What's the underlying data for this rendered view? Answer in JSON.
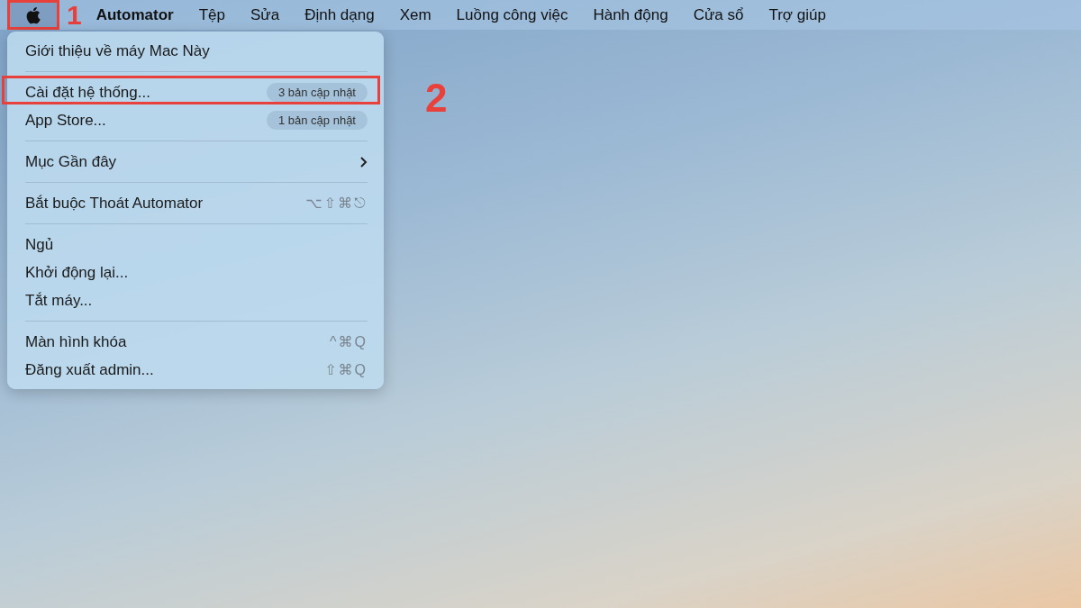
{
  "menu_bar": {
    "apple": {
      "selected": true,
      "annotation": "1"
    },
    "app_name": "Automator",
    "menus": [
      "Tệp",
      "Sửa",
      "Định dạng",
      "Xem",
      "Luồng công việc",
      "Hành động",
      "Cửa sổ",
      "Trợ giúp"
    ]
  },
  "apple_menu": {
    "items": [
      {
        "kind": "item",
        "label": "Giới thiệu về máy Mac Này"
      },
      {
        "kind": "separator"
      },
      {
        "kind": "item",
        "label": "Cài đặt hệ thống...",
        "badge": "3 bản cập nhật",
        "annotation": "2"
      },
      {
        "kind": "item",
        "label": "App Store...",
        "badge": "1 bản cập nhật"
      },
      {
        "kind": "separator"
      },
      {
        "kind": "submenu",
        "label": "Mục Gần đây"
      },
      {
        "kind": "separator"
      },
      {
        "kind": "item",
        "label": "Bắt buộc Thoát Automator",
        "shortcut": "⌥⇧⌘⎋"
      },
      {
        "kind": "separator"
      },
      {
        "kind": "item",
        "label": "Ngủ"
      },
      {
        "kind": "item",
        "label": "Khởi động lại..."
      },
      {
        "kind": "item",
        "label": "Tắt máy..."
      },
      {
        "kind": "separator"
      },
      {
        "kind": "item",
        "label": "Màn hình khóa",
        "shortcut": "^⌘Q"
      },
      {
        "kind": "item",
        "label": "Đăng xuất admin...",
        "shortcut": "⇧⌘Q"
      }
    ]
  }
}
